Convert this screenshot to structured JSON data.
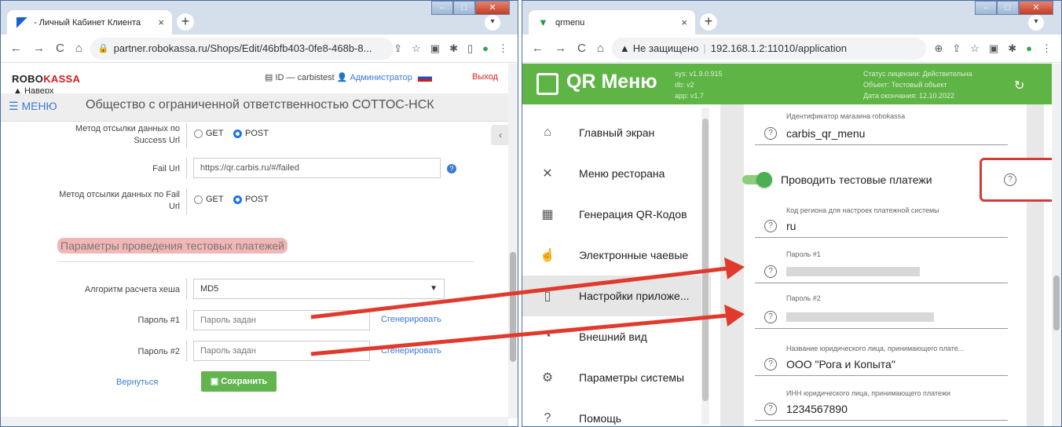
{
  "left": {
    "tab_title": "- Личный Кабинет Клиента",
    "url": "partner.robokassa.ru/Shops/Edit/46bfb403-0fe8-468b-8...",
    "logo_a": "ROBO",
    "logo_b": "KASSA",
    "back_to_top": "▲ Наверх",
    "id_text": "ID — carbistest",
    "role": "Администратор",
    "exit": "Выход",
    "menu": "☰ МЕНЮ",
    "org": "Общество с ограниченной ответственностью СОТТОС-НСК",
    "success_method_label": "Метод отсылки данных по Success Url",
    "get": "GET",
    "post": "POST",
    "fail_url_label": "Fail Url",
    "fail_url_value": "https://qr.carbis.ru/#/failed",
    "fail_method_label": "Метод отсылки данных по Fail Url",
    "section_title": "Параметры проведения тестовых платежей",
    "hash_label": "Алгоритм расчета хеша",
    "hash_value": "MD5",
    "pass1_label": "Пароль #1",
    "pass2_label": "Пароль #2",
    "pass_placeholder": "Пароль задан",
    "generate": "Сгенерировать",
    "back": "Вернуться",
    "save": "Сохранить"
  },
  "right": {
    "tab_title": "qrmenu",
    "not_secure": "Не защищено",
    "url": "192.168.1.2:11010/application",
    "app_title": "QR Меню",
    "ver_sys": "sys: v1.9.0.915",
    "ver_db": "db: v2",
    "ver_app": "app: v1.7",
    "lic_status": "Статус лицензии: Действительна",
    "lic_object": "Объект: Тестовый объект",
    "lic_end": "Дата окончания: 12.10.2022",
    "nav": [
      {
        "label": "Главный экран",
        "icon": "home-icon",
        "glyph": "⌂"
      },
      {
        "label": "Меню ресторана",
        "icon": "utensils-icon",
        "glyph": "✕"
      },
      {
        "label": "Генерация QR-Кодов",
        "icon": "qr-icon",
        "glyph": "▦"
      },
      {
        "label": "Электронные чаевые",
        "icon": "tips-icon",
        "glyph": "☝"
      },
      {
        "label": "Настройки приложе...",
        "icon": "settings-phone-icon",
        "glyph": "▯"
      },
      {
        "label": "Внешний вид",
        "icon": "palette-icon",
        "glyph": "◔"
      },
      {
        "label": "Параметры системы",
        "icon": "gear-icon",
        "glyph": "⚙"
      },
      {
        "label": "Помощь",
        "icon": "help-icon",
        "glyph": "?"
      }
    ],
    "fields": {
      "shop_id_caption": "Идентификатор магазина robokassa",
      "shop_id_value": "carbis_qr_menu",
      "toggle_label": "Проводить тестовые платежи",
      "region_caption": "Код региона для настроек платежной системы",
      "region_value": "ru",
      "pass1_caption": "Пароль #1",
      "pass2_caption": "Пароль #2",
      "legal_caption": "Название юридического лица, принимающего плате...",
      "legal_value": "ООО \"Рога и Копыта\"",
      "inn_caption": "ИНН юридического лица, принимающего платежи",
      "inn_value": "1234567890"
    }
  },
  "colors": {
    "green": "#5fb446",
    "red": "#d63b33",
    "blue": "#3a7bd5"
  }
}
